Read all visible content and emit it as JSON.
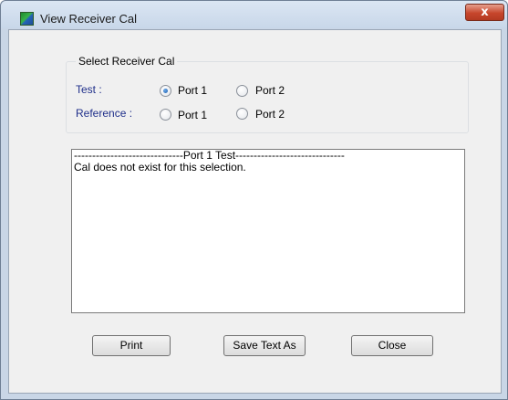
{
  "window": {
    "title": "View Receiver Cal",
    "close_label": "x",
    "icon": "app-logo-icon"
  },
  "selector": {
    "group_title": "Select Receiver Cal",
    "test": {
      "label": "Test :",
      "options": [
        "Port 1",
        "Port 2"
      ],
      "selected": "Port 1"
    },
    "reference": {
      "label": "Reference :",
      "options": [
        "Port 1",
        "Port 2"
      ],
      "selected": null
    }
  },
  "output": {
    "lines": [
      "------------------------------Port 1 Test------------------------------",
      "Cal does not exist for this selection."
    ]
  },
  "buttons": {
    "print": "Print",
    "save": "Save Text As",
    "close": "Close"
  },
  "colors": {
    "label_blue": "#1f2f8a",
    "close_red": "#c7462c"
  }
}
